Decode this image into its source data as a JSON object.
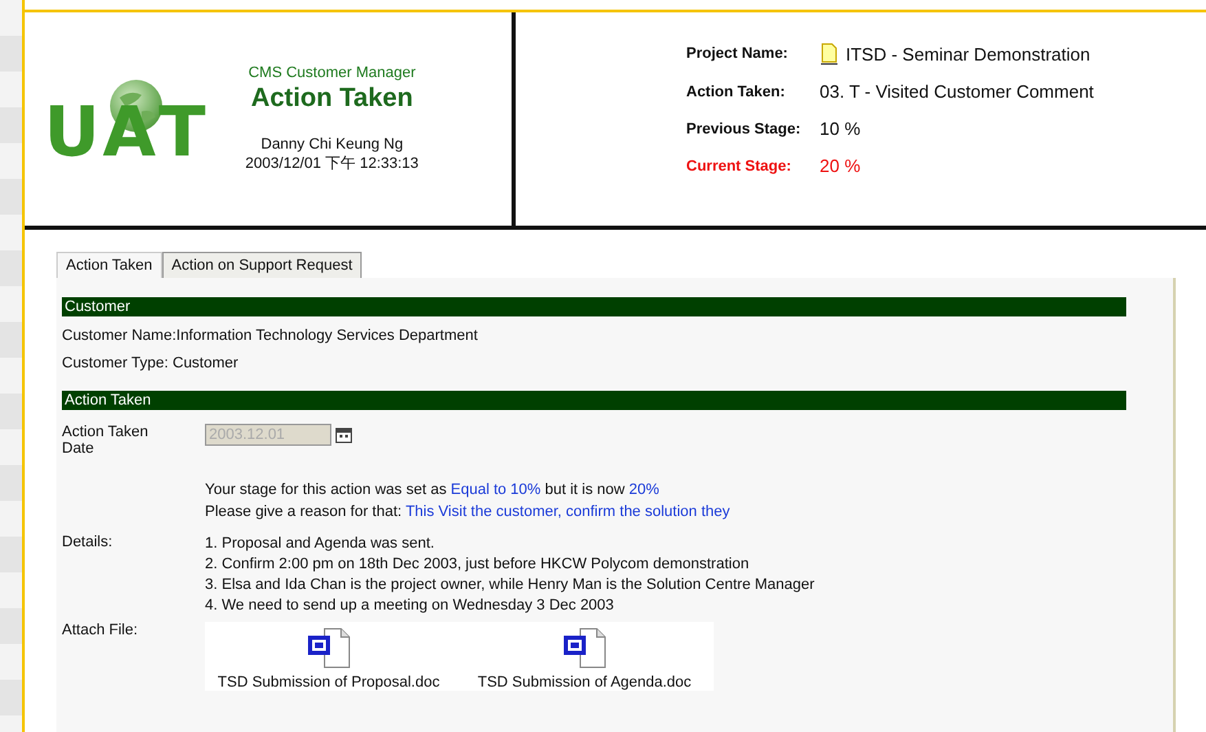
{
  "header": {
    "logo": [
      "U",
      "A",
      "T"
    ],
    "app_name": "CMS Customer Manager",
    "title": "Action Taken",
    "user": "Danny Chi Keung Ng",
    "timestamp": "2003/12/01 下午 12:33:13",
    "fields": [
      {
        "label": "Project Name:",
        "value": "ITSD - Seminar Demonstration",
        "kind": "project",
        "highlight": false
      },
      {
        "label": "Action Taken:",
        "value": "03. T - Visited Customer Comment",
        "kind": "text",
        "highlight": false
      },
      {
        "label": "Previous Stage:",
        "value": "10 %",
        "kind": "text",
        "highlight": false
      },
      {
        "label": "Current Stage:",
        "value": "20 %",
        "kind": "text",
        "highlight": true
      }
    ]
  },
  "tabs": [
    {
      "label": "Action Taken",
      "selected": true
    },
    {
      "label": "Action on Support Request",
      "selected": false
    }
  ],
  "customer": {
    "title": "Customer",
    "lines": [
      "Customer Name:Information Technology Services Department",
      "Customer Type: Customer"
    ]
  },
  "action": {
    "title": "Action Taken",
    "date_label": "Action Taken Date",
    "date": {
      "value": "2003.12.01",
      "disabled": true
    },
    "notes": [
      [
        {
          "text": "Your stage for this action was set as ",
          "link": false
        },
        {
          "text": "Equal to 10%",
          "link": true
        },
        {
          "text": " but it is now ",
          "link": false
        },
        {
          "text": "20%",
          "link": true
        }
      ],
      [
        {
          "text": "Please give a reason for that: ",
          "link": false
        },
        {
          "text": "This Visit the customer, confirm the solution they",
          "link": true
        }
      ]
    ],
    "details_label": "Details:",
    "details": [
      "1. Proposal and Agenda was sent.",
      "2. Confirm 2:00 pm on 18th Dec 2003, just before HKCW Polycom demonstration",
      "3. Elsa and Ida Chan is the project owner, while Henry Man is the Solution Centre Manager",
      "4. We need to send up a meeting on Wednesday 3 Dec 2003"
    ],
    "attach_label": "Attach File:",
    "files": [
      "TSD Submission of Proposal.doc",
      "TSD Submission of Agenda.doc"
    ]
  }
}
